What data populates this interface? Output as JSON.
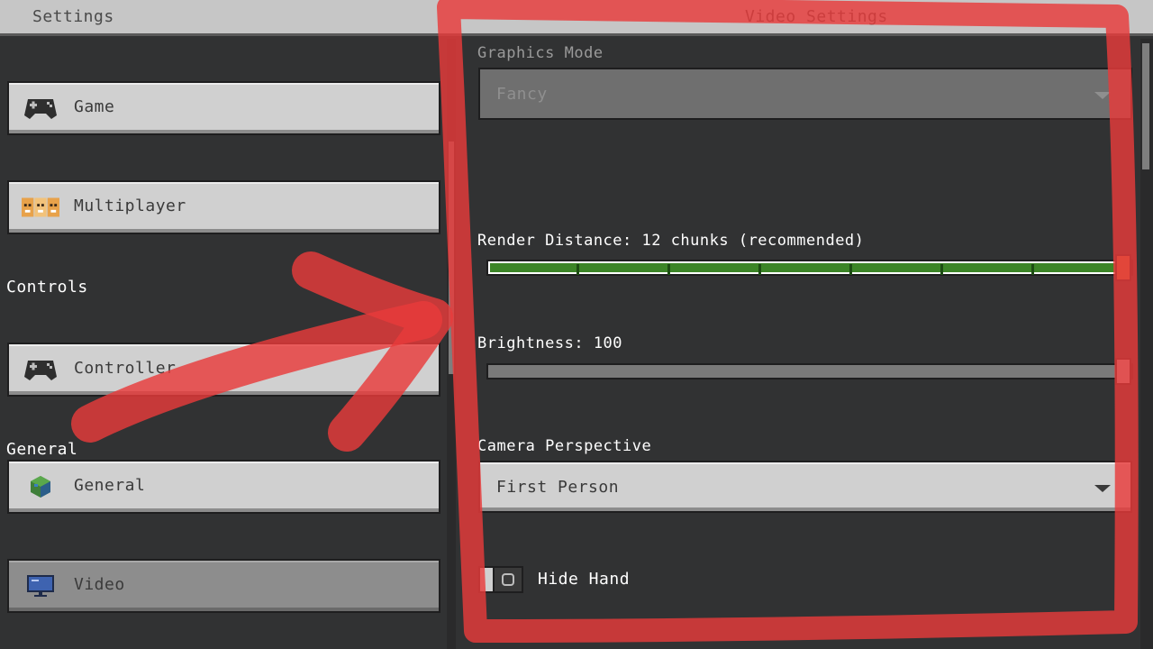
{
  "header": {
    "left_title": "Settings",
    "right_title": "Video Settings"
  },
  "sidebar": {
    "items": [
      {
        "label": "Game",
        "icon": "gamepad-icon"
      },
      {
        "label": "Multiplayer",
        "icon": "players-icon"
      },
      {
        "label": "Controller",
        "icon": "gamepad-icon"
      },
      {
        "label": "General",
        "icon": "globe-icon"
      },
      {
        "label": "Video",
        "icon": "monitor-icon",
        "selected": true
      }
    ],
    "sections": {
      "controls": "Controls",
      "general": "General"
    }
  },
  "video": {
    "graphics_mode": {
      "label": "Graphics Mode",
      "value": "Fancy",
      "enabled": false
    },
    "render_distance": {
      "label": "Render Distance: 12 chunks (recommended)",
      "value": 12,
      "fraction": 1.0
    },
    "brightness": {
      "label": "Brightness: 100",
      "value": 100,
      "fraction": 1.0
    },
    "camera_perspective": {
      "label": "Camera Perspective",
      "value": "First Person"
    },
    "hide_hand": {
      "label": "Hide Hand",
      "on": false,
      "toggle_glyph": "O"
    }
  },
  "colors": {
    "annotation": "#e83b3b",
    "slider_green": "#3c8527",
    "panel_bg": "#313233"
  }
}
